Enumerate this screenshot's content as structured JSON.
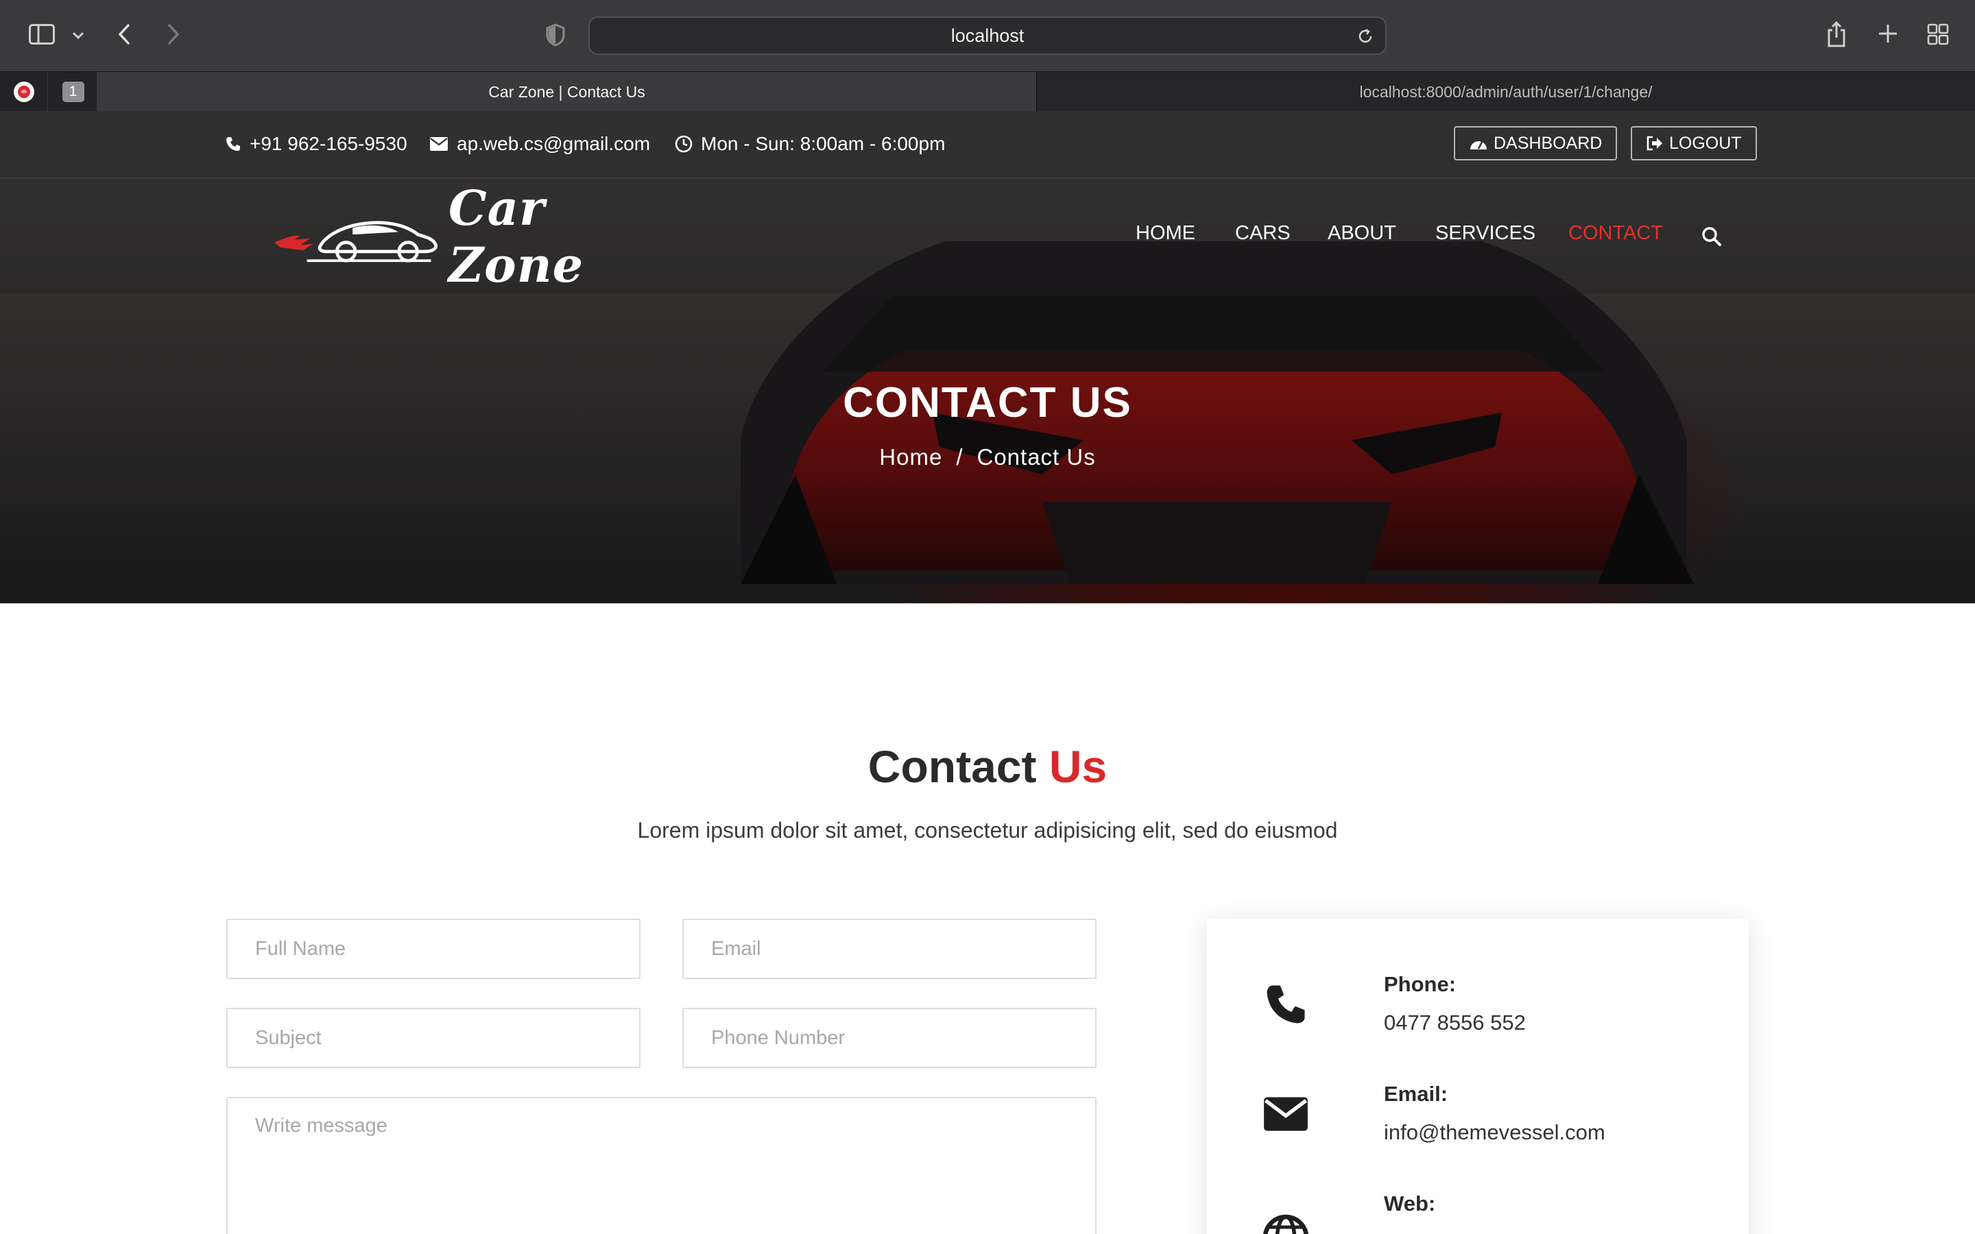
{
  "browser": {
    "url": "localhost",
    "tabs": [
      {
        "label": "Car Zone | Contact Us",
        "active": true
      },
      {
        "label": "localhost:8000/admin/auth/user/1/change/",
        "active": false
      }
    ],
    "pinned_tab_badge": "1"
  },
  "topbar": {
    "phone": "+91 962-165-9530",
    "email": "ap.web.cs@gmail.com",
    "hours": "Mon - Sun: 8:00am - 6:00pm",
    "dashboard_label": "DASHBOARD",
    "logout_label": "LOGOUT"
  },
  "brand": {
    "name": "Car Zone"
  },
  "nav": {
    "items": [
      {
        "label": "HOME"
      },
      {
        "label": "CARS"
      },
      {
        "label": "ABOUT"
      },
      {
        "label": "SERVICES"
      },
      {
        "label": "CONTACT",
        "active": true
      }
    ]
  },
  "hero": {
    "title": "CONTACT US",
    "breadcrumb": {
      "home": "Home",
      "separator": "/",
      "current": "Contact Us"
    }
  },
  "contact_section": {
    "title_main": "Contact",
    "title_accent": "Us",
    "subtitle": "Lorem ipsum dolor sit amet, consectetur adipisicing elit, sed do eiusmod"
  },
  "form": {
    "full_name_placeholder": "Full Name",
    "email_placeholder": "Email",
    "subject_placeholder": "Subject",
    "phone_placeholder": "Phone Number",
    "message_placeholder": "Write message"
  },
  "info_card": {
    "phone_label": "Phone:",
    "phone_value": "0477 8556 552",
    "email_label": "Email:",
    "email_value": "info@themevessel.com",
    "web_label": "Web:"
  },
  "colors": {
    "accent": "#d9292a",
    "nav_active": "#e0322f",
    "toolbar": "#3a3a3c"
  }
}
